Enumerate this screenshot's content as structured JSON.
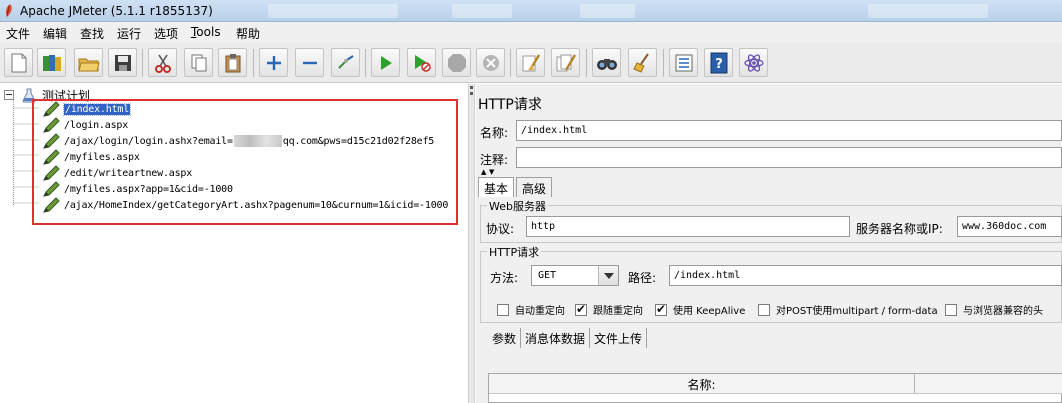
{
  "window": {
    "title": "Apache JMeter (5.1.1 r1855137)"
  },
  "menu": [
    {
      "label": "文件"
    },
    {
      "label": "编辑"
    },
    {
      "label": "查找"
    },
    {
      "label": "运行"
    },
    {
      "label": "选项"
    },
    {
      "label_pre": "",
      "label_u": "T",
      "label_post": "ools"
    },
    {
      "label": "帮助"
    }
  ],
  "toolbar": {
    "icons": [
      "new-icon",
      "templates-icon",
      "open-icon",
      "save-icon",
      "cut-icon",
      "copy-icon",
      "paste-icon",
      "expand-icon",
      "collapse-icon",
      "toggle-icon",
      "start-icon",
      "start-no-pauses-icon",
      "stop-icon",
      "shutdown-icon",
      "clear-icon",
      "clear-all-icon",
      "search-icon",
      "reset-search-icon",
      "function-helper-icon",
      "help-icon",
      "log-viewer-icon"
    ]
  },
  "tree": {
    "root_label": "测试计划",
    "samplers": [
      {
        "label": "/index.html",
        "selected": true
      },
      {
        "label": "/login.aspx"
      },
      {
        "label_pre": "/ajax/login/login.ashx?email=",
        "label_post": "qq.com&pws=d15c21d02f28ef5"
      },
      {
        "label": "/myfiles.aspx"
      },
      {
        "label": "/edit/writeartnew.aspx"
      },
      {
        "label": "/myfiles.aspx?app=1&cid=-1000"
      },
      {
        "label": "/ajax/HomeIndex/getCategoryArt.ashx?pagenum=10&curnum=1&icid=-1000"
      }
    ]
  },
  "panel": {
    "title": "HTTP请求",
    "name_label": "名称:",
    "name_value": "/index.html",
    "comment_label": "注释:",
    "comment_value": "",
    "tabs": [
      "基本",
      "高级"
    ],
    "web_server": {
      "group_title": "Web服务器",
      "protocol_label": "协议:",
      "protocol_value": "http",
      "server_label": "服务器名称或IP:",
      "server_value": "www.360doc.com"
    },
    "http_request": {
      "group_title": "HTTP请求",
      "method_label": "方法:",
      "method_value": "GET",
      "path_label": "路径:",
      "path_value": "/index.html"
    },
    "checkboxes": [
      {
        "label": "自动重定向",
        "checked": false
      },
      {
        "label": "跟随重定向",
        "checked": true
      },
      {
        "label": "使用 KeepAlive",
        "checked": true
      },
      {
        "label": "对POST使用multipart / form-data",
        "checked": false
      },
      {
        "label": "与浏览器兼容的头",
        "checked": false
      }
    ],
    "subtabs": [
      "参数",
      "消息体数据",
      "文件上传"
    ],
    "table": {
      "columns": [
        "名称:",
        ""
      ]
    }
  },
  "colors": {
    "selection": "#3163c5",
    "highlight_border": "#e03131",
    "panel_bg": "#f0f0f0"
  }
}
